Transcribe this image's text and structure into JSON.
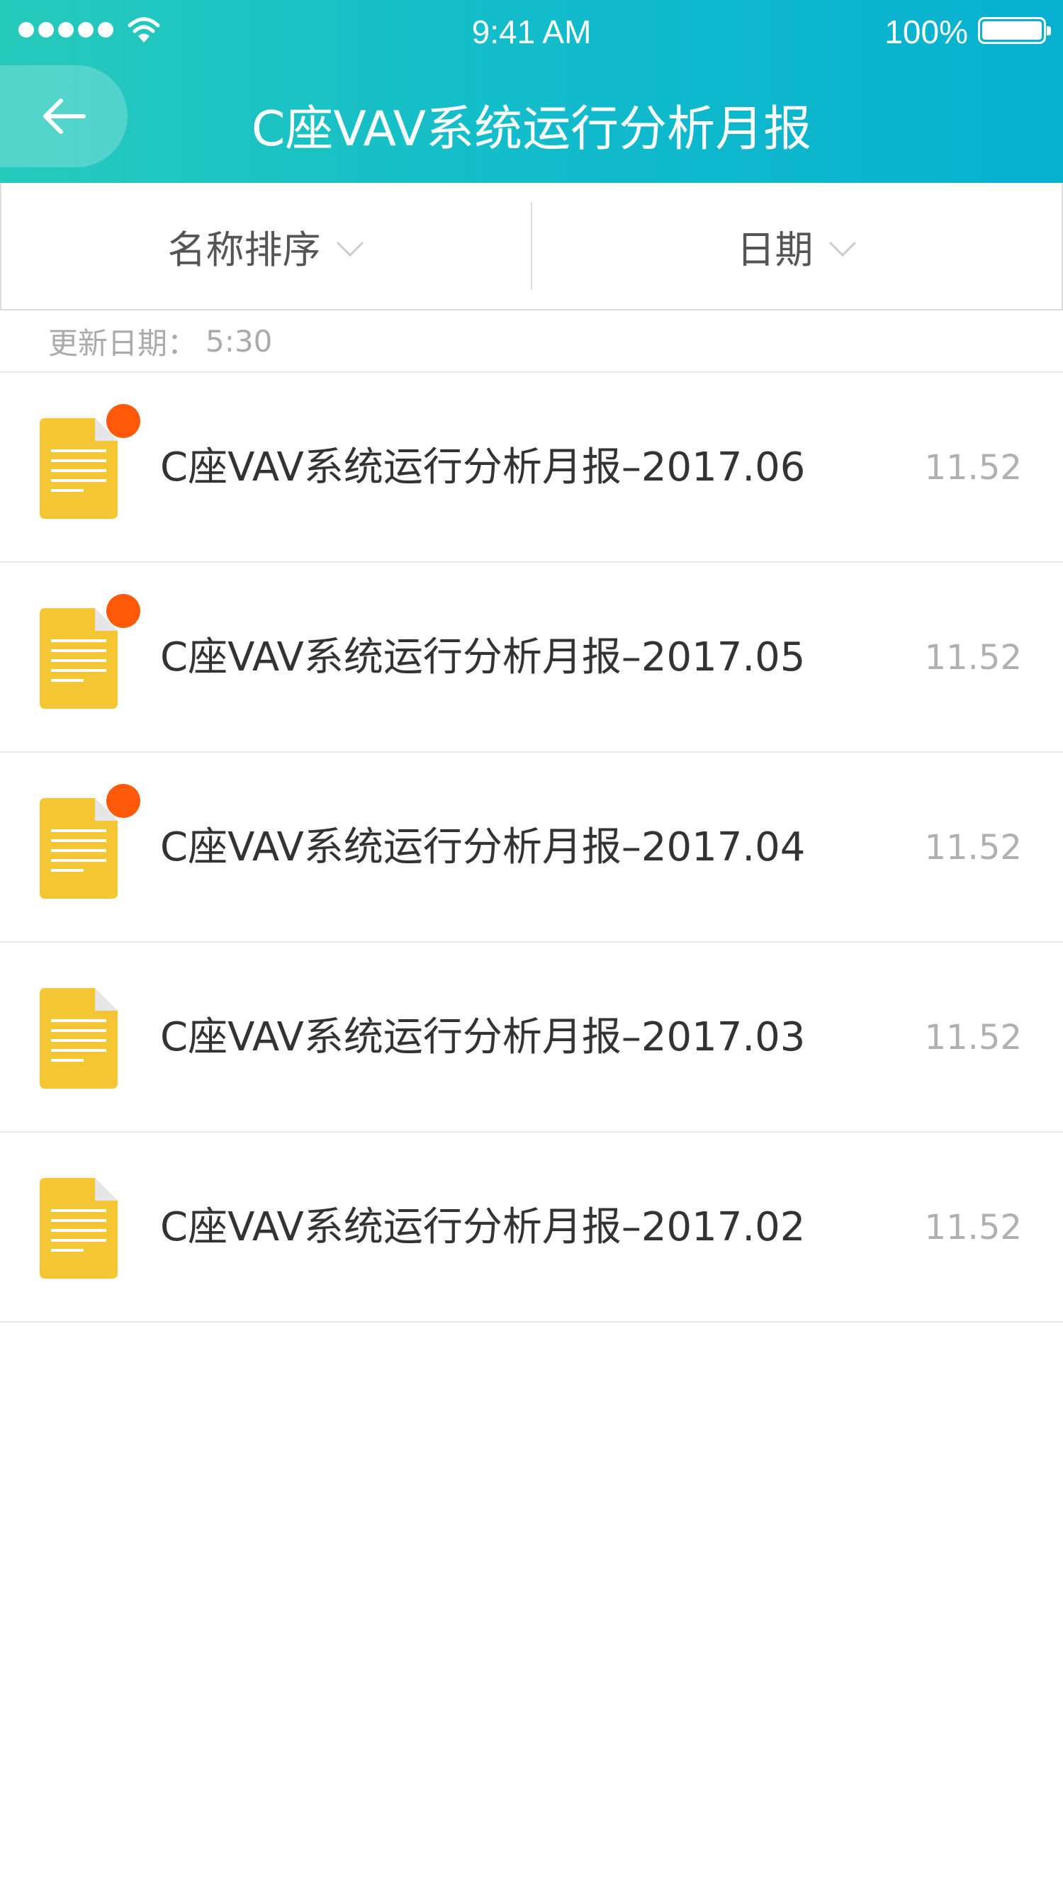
{
  "status_bar": {
    "time": "9:41 AM",
    "battery_percent": "100%",
    "signal_dots": 5
  },
  "nav": {
    "title": "C座VAV系统运行分析月报"
  },
  "filters": [
    {
      "label": "名称排序"
    },
    {
      "label": "日期"
    }
  ],
  "update": {
    "label": "更新日期：",
    "value": "5:30"
  },
  "reports": [
    {
      "title": "C座VAV系统运行分析月报–2017.06",
      "size": "11.52",
      "unread": true
    },
    {
      "title": "C座VAV系统运行分析月报–2017.05",
      "size": "11.52",
      "unread": true
    },
    {
      "title": "C座VAV系统运行分析月报–2017.04",
      "size": "11.52",
      "unread": true
    },
    {
      "title": "C座VAV系统运行分析月报–2017.03",
      "size": "11.52",
      "unread": false
    },
    {
      "title": "C座VAV系统运行分析月报–2017.02",
      "size": "11.52",
      "unread": false
    }
  ],
  "colors": {
    "header_start": "#26cabb",
    "header_end": "#07b0cf",
    "doc_icon": "#f5c633",
    "badge": "#ff5a0a"
  }
}
